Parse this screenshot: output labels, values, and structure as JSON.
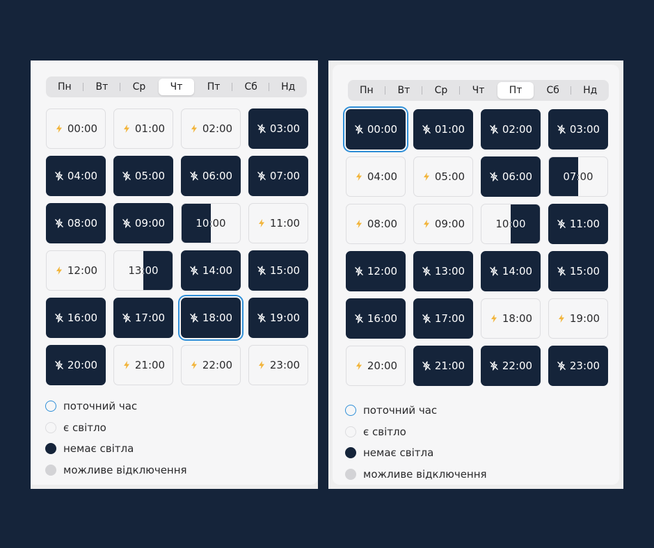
{
  "schedules": [
    {
      "days": [
        "Пн",
        "Вт",
        "Ср",
        "Чт",
        "Пт",
        "Сб",
        "Нд"
      ],
      "active_day": 3,
      "current_hour": 18,
      "slots": [
        {
          "time": "00:00",
          "state": "on"
        },
        {
          "time": "01:00",
          "state": "on"
        },
        {
          "time": "02:00",
          "state": "on"
        },
        {
          "time": "03:00",
          "state": "off"
        },
        {
          "time": "04:00",
          "state": "off"
        },
        {
          "time": "05:00",
          "state": "off"
        },
        {
          "time": "06:00",
          "state": "off"
        },
        {
          "time": "07:00",
          "state": "off"
        },
        {
          "time": "08:00",
          "state": "off"
        },
        {
          "time": "09:00",
          "state": "off"
        },
        {
          "time": "10:00",
          "state": "half-first"
        },
        {
          "time": "11:00",
          "state": "on"
        },
        {
          "time": "12:00",
          "state": "on"
        },
        {
          "time": "13:00",
          "state": "half-second"
        },
        {
          "time": "14:00",
          "state": "off"
        },
        {
          "time": "15:00",
          "state": "off"
        },
        {
          "time": "16:00",
          "state": "off"
        },
        {
          "time": "17:00",
          "state": "off"
        },
        {
          "time": "18:00",
          "state": "off"
        },
        {
          "time": "19:00",
          "state": "off"
        },
        {
          "time": "20:00",
          "state": "off"
        },
        {
          "time": "21:00",
          "state": "on"
        },
        {
          "time": "22:00",
          "state": "on"
        },
        {
          "time": "23:00",
          "state": "on"
        }
      ]
    },
    {
      "days": [
        "Пн",
        "Вт",
        "Ср",
        "Чт",
        "Пт",
        "Сб",
        "Нд"
      ],
      "active_day": 4,
      "current_hour": 0,
      "slots": [
        {
          "time": "00:00",
          "state": "off"
        },
        {
          "time": "01:00",
          "state": "off"
        },
        {
          "time": "02:00",
          "state": "off"
        },
        {
          "time": "03:00",
          "state": "off"
        },
        {
          "time": "04:00",
          "state": "on"
        },
        {
          "time": "05:00",
          "state": "on"
        },
        {
          "time": "06:00",
          "state": "off"
        },
        {
          "time": "07:00",
          "state": "half-first"
        },
        {
          "time": "08:00",
          "state": "on"
        },
        {
          "time": "09:00",
          "state": "on"
        },
        {
          "time": "10:00",
          "state": "half-second"
        },
        {
          "time": "11:00",
          "state": "off"
        },
        {
          "time": "12:00",
          "state": "off"
        },
        {
          "time": "13:00",
          "state": "off"
        },
        {
          "time": "14:00",
          "state": "off"
        },
        {
          "time": "15:00",
          "state": "off"
        },
        {
          "time": "16:00",
          "state": "off"
        },
        {
          "time": "17:00",
          "state": "off"
        },
        {
          "time": "18:00",
          "state": "on"
        },
        {
          "time": "19:00",
          "state": "on"
        },
        {
          "time": "20:00",
          "state": "on"
        },
        {
          "time": "21:00",
          "state": "off"
        },
        {
          "time": "22:00",
          "state": "off"
        },
        {
          "time": "23:00",
          "state": "off"
        }
      ]
    }
  ],
  "legend": {
    "current": "поточний час",
    "on": "є світло",
    "off": "немає світла",
    "maybe": "можливе відключення"
  },
  "colors": {
    "background": "#15243a",
    "outage": "#15243a",
    "current_outline": "#2f8fd8",
    "bolt": "#f2b53c",
    "maybe": "#d3d3d6"
  },
  "icons": {
    "on": "lightning-icon",
    "off": "no-power-icon"
  }
}
